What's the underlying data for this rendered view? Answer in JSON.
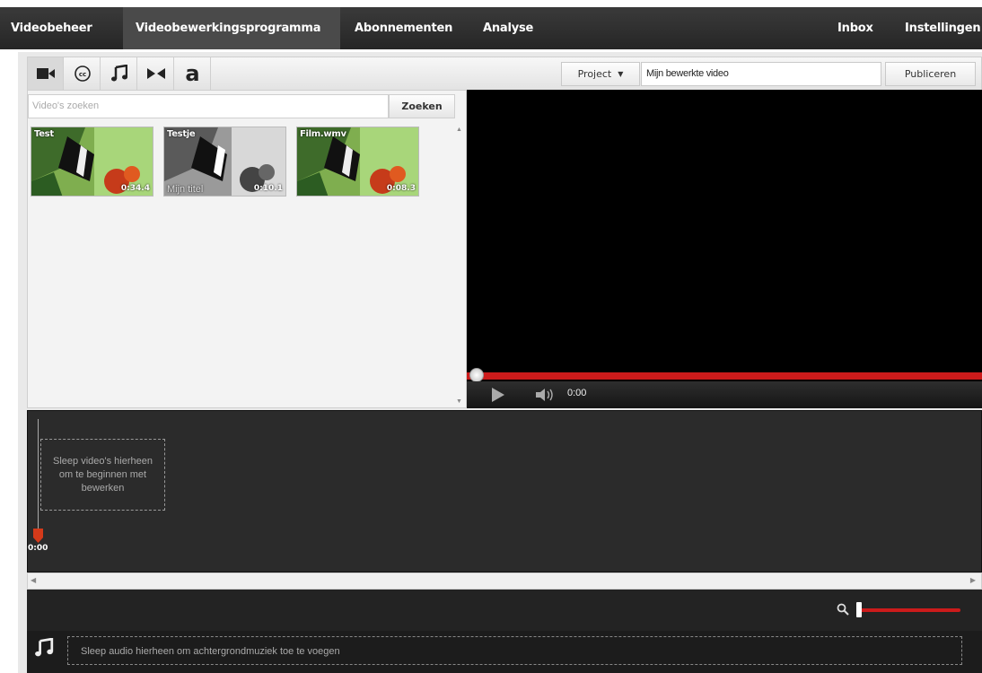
{
  "nav": {
    "items": [
      "Videobeheer",
      "Videobewerkingsprogramma",
      "Abonnementen",
      "Analyse"
    ],
    "right_items": [
      "Inbox",
      "Instellingen"
    ],
    "active": "Videobewerkingsprogramma"
  },
  "toolbar": {
    "tools": [
      "video-camera-icon",
      "captions-icon",
      "music-note-icon",
      "transitions-icon",
      "text-icon"
    ],
    "text_tool_glyph": "a",
    "project_label": "Project",
    "project_title": "Mijn bewerkte video",
    "publish_label": "Publiceren"
  },
  "library": {
    "search_placeholder": "Video's zoeken",
    "search_button": "Zoeken",
    "clips": [
      {
        "title": "Test",
        "duration": "0:34.4",
        "overlay": ""
      },
      {
        "title": "Testje",
        "duration": "0:10.1",
        "overlay": "Mijn titel"
      },
      {
        "title": "Film.wmv",
        "duration": "0:08.3",
        "overlay": ""
      }
    ]
  },
  "player": {
    "timecode": "0:00",
    "progress": 0
  },
  "timeline": {
    "dropzone_text": "Sleep video's hierheen om te beginnen met bewerken",
    "playhead_time": "0:00"
  },
  "audio": {
    "dropzone_text": "Sleep audio hierheen om achtergrondmuziek toe te voegen"
  },
  "colors": {
    "accent": "#cc1b1b",
    "nav_bg": "#2e2e2e",
    "timeline_bg": "#2b2b2b"
  }
}
